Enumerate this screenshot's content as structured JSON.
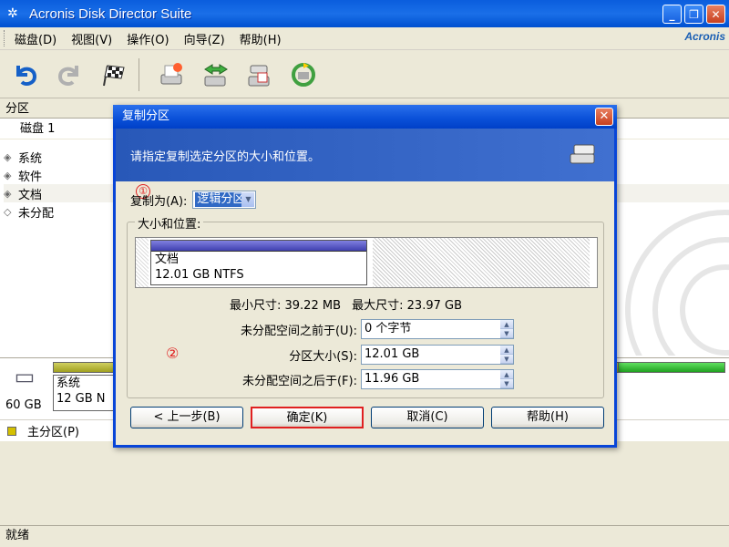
{
  "window": {
    "title": "Acronis Disk Director Suite",
    "brand": "Acronis",
    "minimize_glyph": "_",
    "restore_glyph": "❐",
    "close_glyph": "✕"
  },
  "menu": [
    "磁盘(D)",
    "视图(V)",
    "操作(O)",
    "向导(Z)",
    "帮助(H)"
  ],
  "toolbar": {
    "undo_icon": "undo-icon",
    "redo_icon": "redo-icon",
    "commit_icon": "checkered-flag-icon",
    "tools": [
      "create-partition-icon",
      "resize-partition-icon",
      "copy-partition-icon",
      "recycle-icon"
    ]
  },
  "partition_list": {
    "header": "分区",
    "disk": "磁盘 1",
    "items": [
      "系统",
      "软件",
      "文档",
      "未分配"
    ]
  },
  "disk_map": {
    "disk_size": "60 GB",
    "cell_name": "系统",
    "cell_size": "12 GB  N"
  },
  "legend": {
    "primary": "主分区(P)"
  },
  "status": {
    "text": "就绪"
  },
  "dialog": {
    "title": "复制分区",
    "close_glyph": "✕",
    "header_text": "请指定复制选定分区的大小和位置。",
    "copy_as_label": "复制为(A):",
    "copy_as_value": "逻辑分区",
    "marker1": "①",
    "marker2": "②",
    "group_label": "大小和位置:",
    "partition_name": "文档",
    "partition_info": "12.01 GB  NTFS",
    "min_size": "最小尺寸: 39.22 MB",
    "max_size": "最大尺寸: 23.97 GB",
    "fields": [
      {
        "label": "未分配空间之前于(U):",
        "value": "0 个字节"
      },
      {
        "label": "分区大小(S):",
        "value": "12.01 GB"
      },
      {
        "label": "未分配空间之后于(F):",
        "value": "11.96 GB"
      }
    ],
    "buttons": {
      "back": "< 上一步(B)",
      "ok": "确定(K)",
      "cancel": "取消(C)",
      "help": "帮助(H)"
    }
  },
  "colors": {
    "titlebar": "#0a5ddd",
    "dialog_header": "#2858b8",
    "highlight": "#316ac5",
    "marker": "#e02020",
    "primary_partition": "#d4c000"
  }
}
